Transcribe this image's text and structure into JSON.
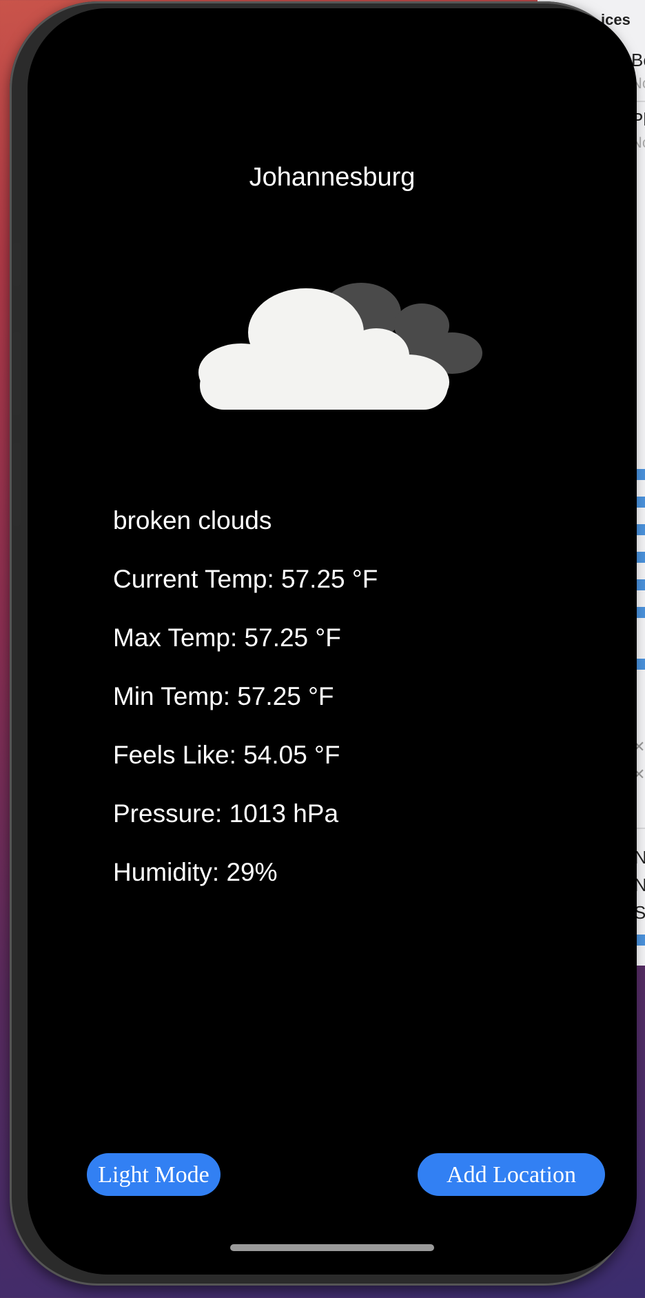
{
  "background_window": {
    "header_fragment": "ices",
    "rows": [
      {
        "title": "Bo",
        "subtitle": "No"
      },
      {
        "title": "Pl",
        "subtitle": "No"
      }
    ],
    "letters": [
      "N",
      "N",
      "S"
    ]
  },
  "app": {
    "city": "Johannesburg",
    "weather_icon": "broken-clouds-icon",
    "description": "broken clouds",
    "current_temp": "Current Temp: 57.25 °F",
    "max_temp": "Max Temp: 57.25 °F",
    "min_temp": "Min Temp: 57.25 °F",
    "feels_like": "Feels Like: 54.05 °F",
    "pressure": "Pressure: 1013 hPa",
    "humidity": "Humidity: 29%"
  },
  "buttons": {
    "light_mode": "Light Mode",
    "add_location": "Add Location"
  },
  "colors": {
    "screen_bg": "#000000",
    "text": "#ffffff",
    "button_bg": "#3280f3",
    "cloud_front": "#f3f3f1",
    "cloud_back": "#4a4a4a"
  }
}
